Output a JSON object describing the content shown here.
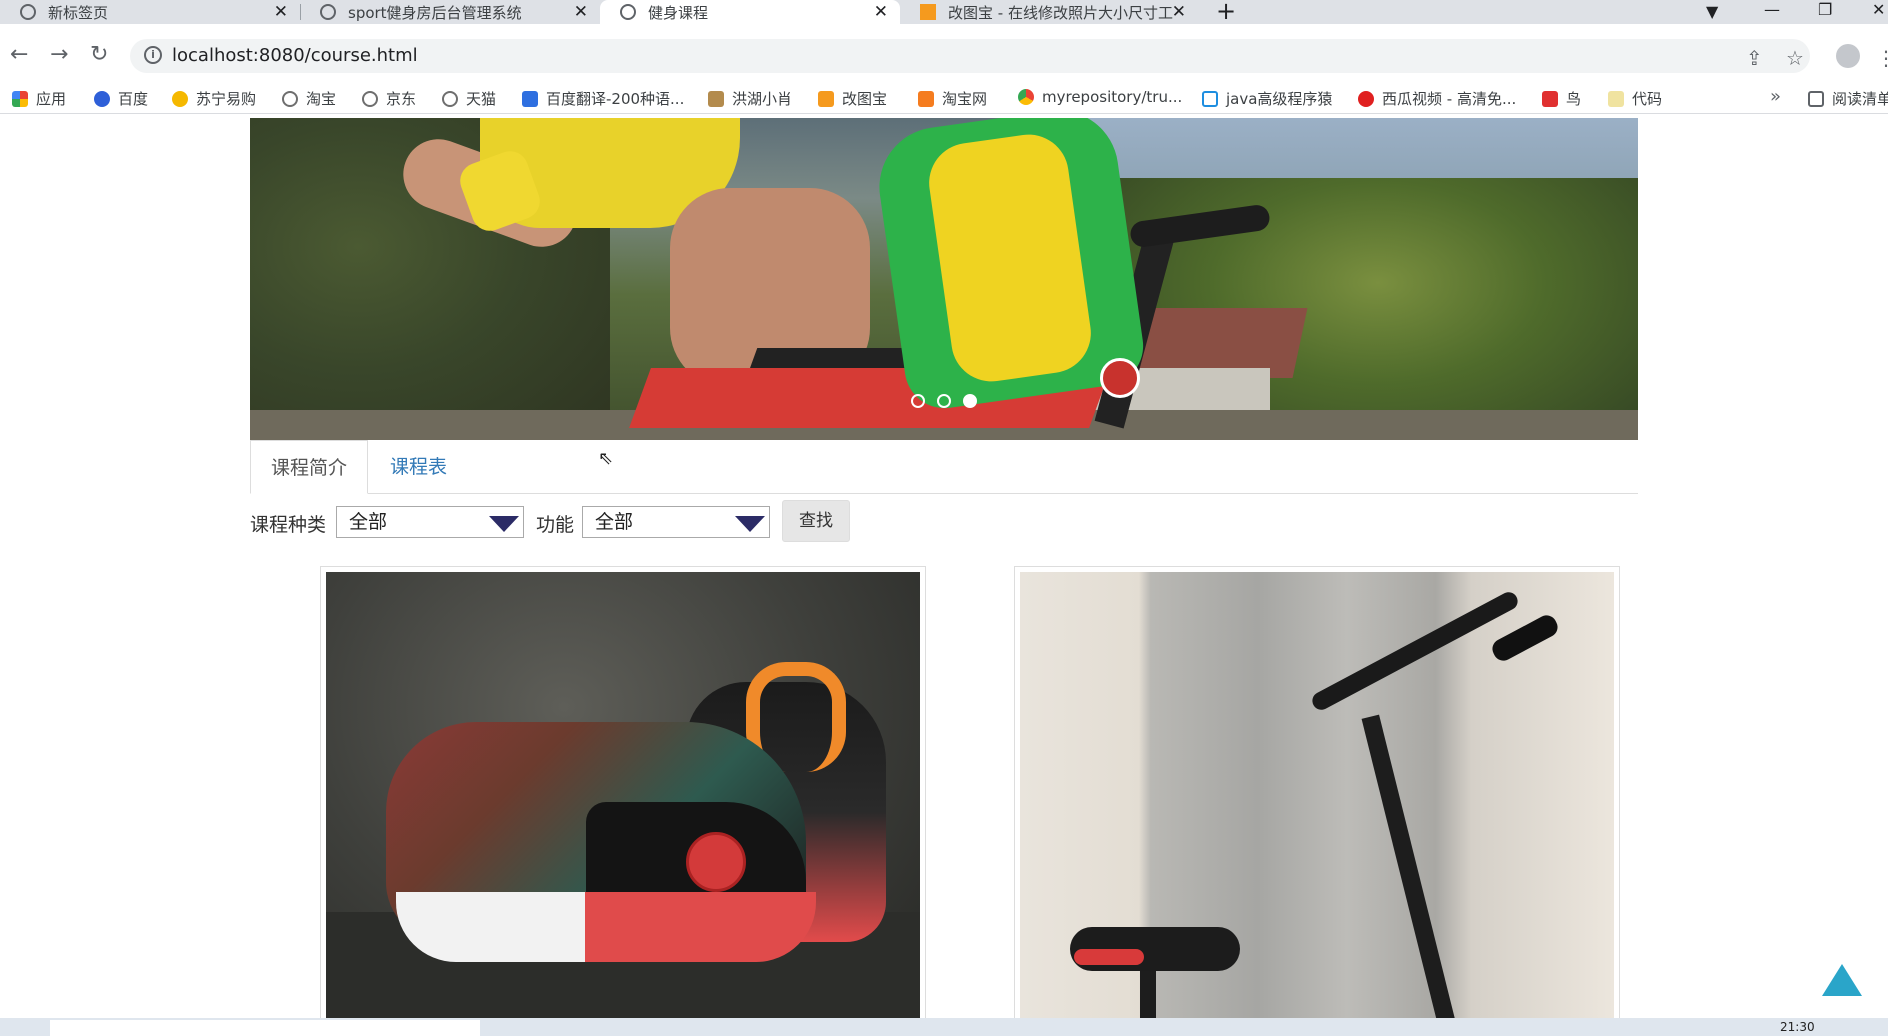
{
  "browser": {
    "tabs": [
      {
        "title": "新标签页",
        "active": false
      },
      {
        "title": "sport健身房后台管理系统",
        "active": false
      },
      {
        "title": "健身课程",
        "active": true
      },
      {
        "title": "改图宝 - 在线修改照片大小尺寸工",
        "active": false
      }
    ],
    "url": "localhost:8080/course.html",
    "bookmarks": [
      {
        "label": "应用",
        "color": "#4285f4"
      },
      {
        "label": "百度",
        "color": "#2e5fd8"
      },
      {
        "label": "苏宁易购",
        "color": "#f5b800"
      },
      {
        "label": "淘宝",
        "color": "#6e6e6e"
      },
      {
        "label": "京东",
        "color": "#6e6e6e"
      },
      {
        "label": "天猫",
        "color": "#6e6e6e"
      },
      {
        "label": "百度翻译-200种语...",
        "color": "#2e6fe0"
      },
      {
        "label": "洪湖小肖",
        "color": "#b38b4d"
      },
      {
        "label": "改图宝",
        "color": "#f59a1e"
      },
      {
        "label": "淘宝网",
        "color": "#f57c1f"
      },
      {
        "label": "myrepository/tru...",
        "color": "#3c8d3c"
      },
      {
        "label": "java高级程序猿",
        "color": "#1e8ee0"
      },
      {
        "label": "西瓜视频 - 高清免...",
        "color": "#e02020"
      },
      {
        "label": "鸟",
        "color": "#e03030"
      },
      {
        "label": "代码",
        "color": "#f0e3a0"
      }
    ],
    "reading_list": "阅读清单"
  },
  "page": {
    "carousel": {
      "active_index": 2,
      "count": 3
    },
    "tabs": {
      "intro": "课程简介",
      "schedule": "课程表"
    },
    "filters": {
      "category_label": "课程种类",
      "category_value": "全部",
      "function_label": "功能",
      "function_value": "全部",
      "search_button": "查找"
    }
  },
  "taskbar": {
    "clock": "21:30"
  }
}
